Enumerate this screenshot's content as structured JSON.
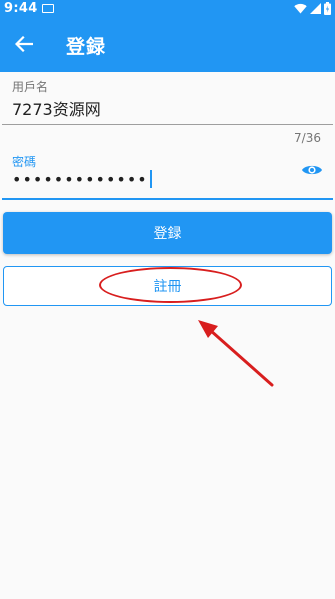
{
  "status_bar": {
    "time": "9:44"
  },
  "app_bar": {
    "title": "登録"
  },
  "username_field": {
    "label": "用戶名",
    "value": "7273资源网"
  },
  "password_field": {
    "label": "密碼",
    "masked_value": "•••••••••••••",
    "counter": "7/36"
  },
  "buttons": {
    "login_label": "登録",
    "register_label": "註冊"
  },
  "colors": {
    "primary": "#2196f3",
    "annotation": "#d81e1e"
  }
}
